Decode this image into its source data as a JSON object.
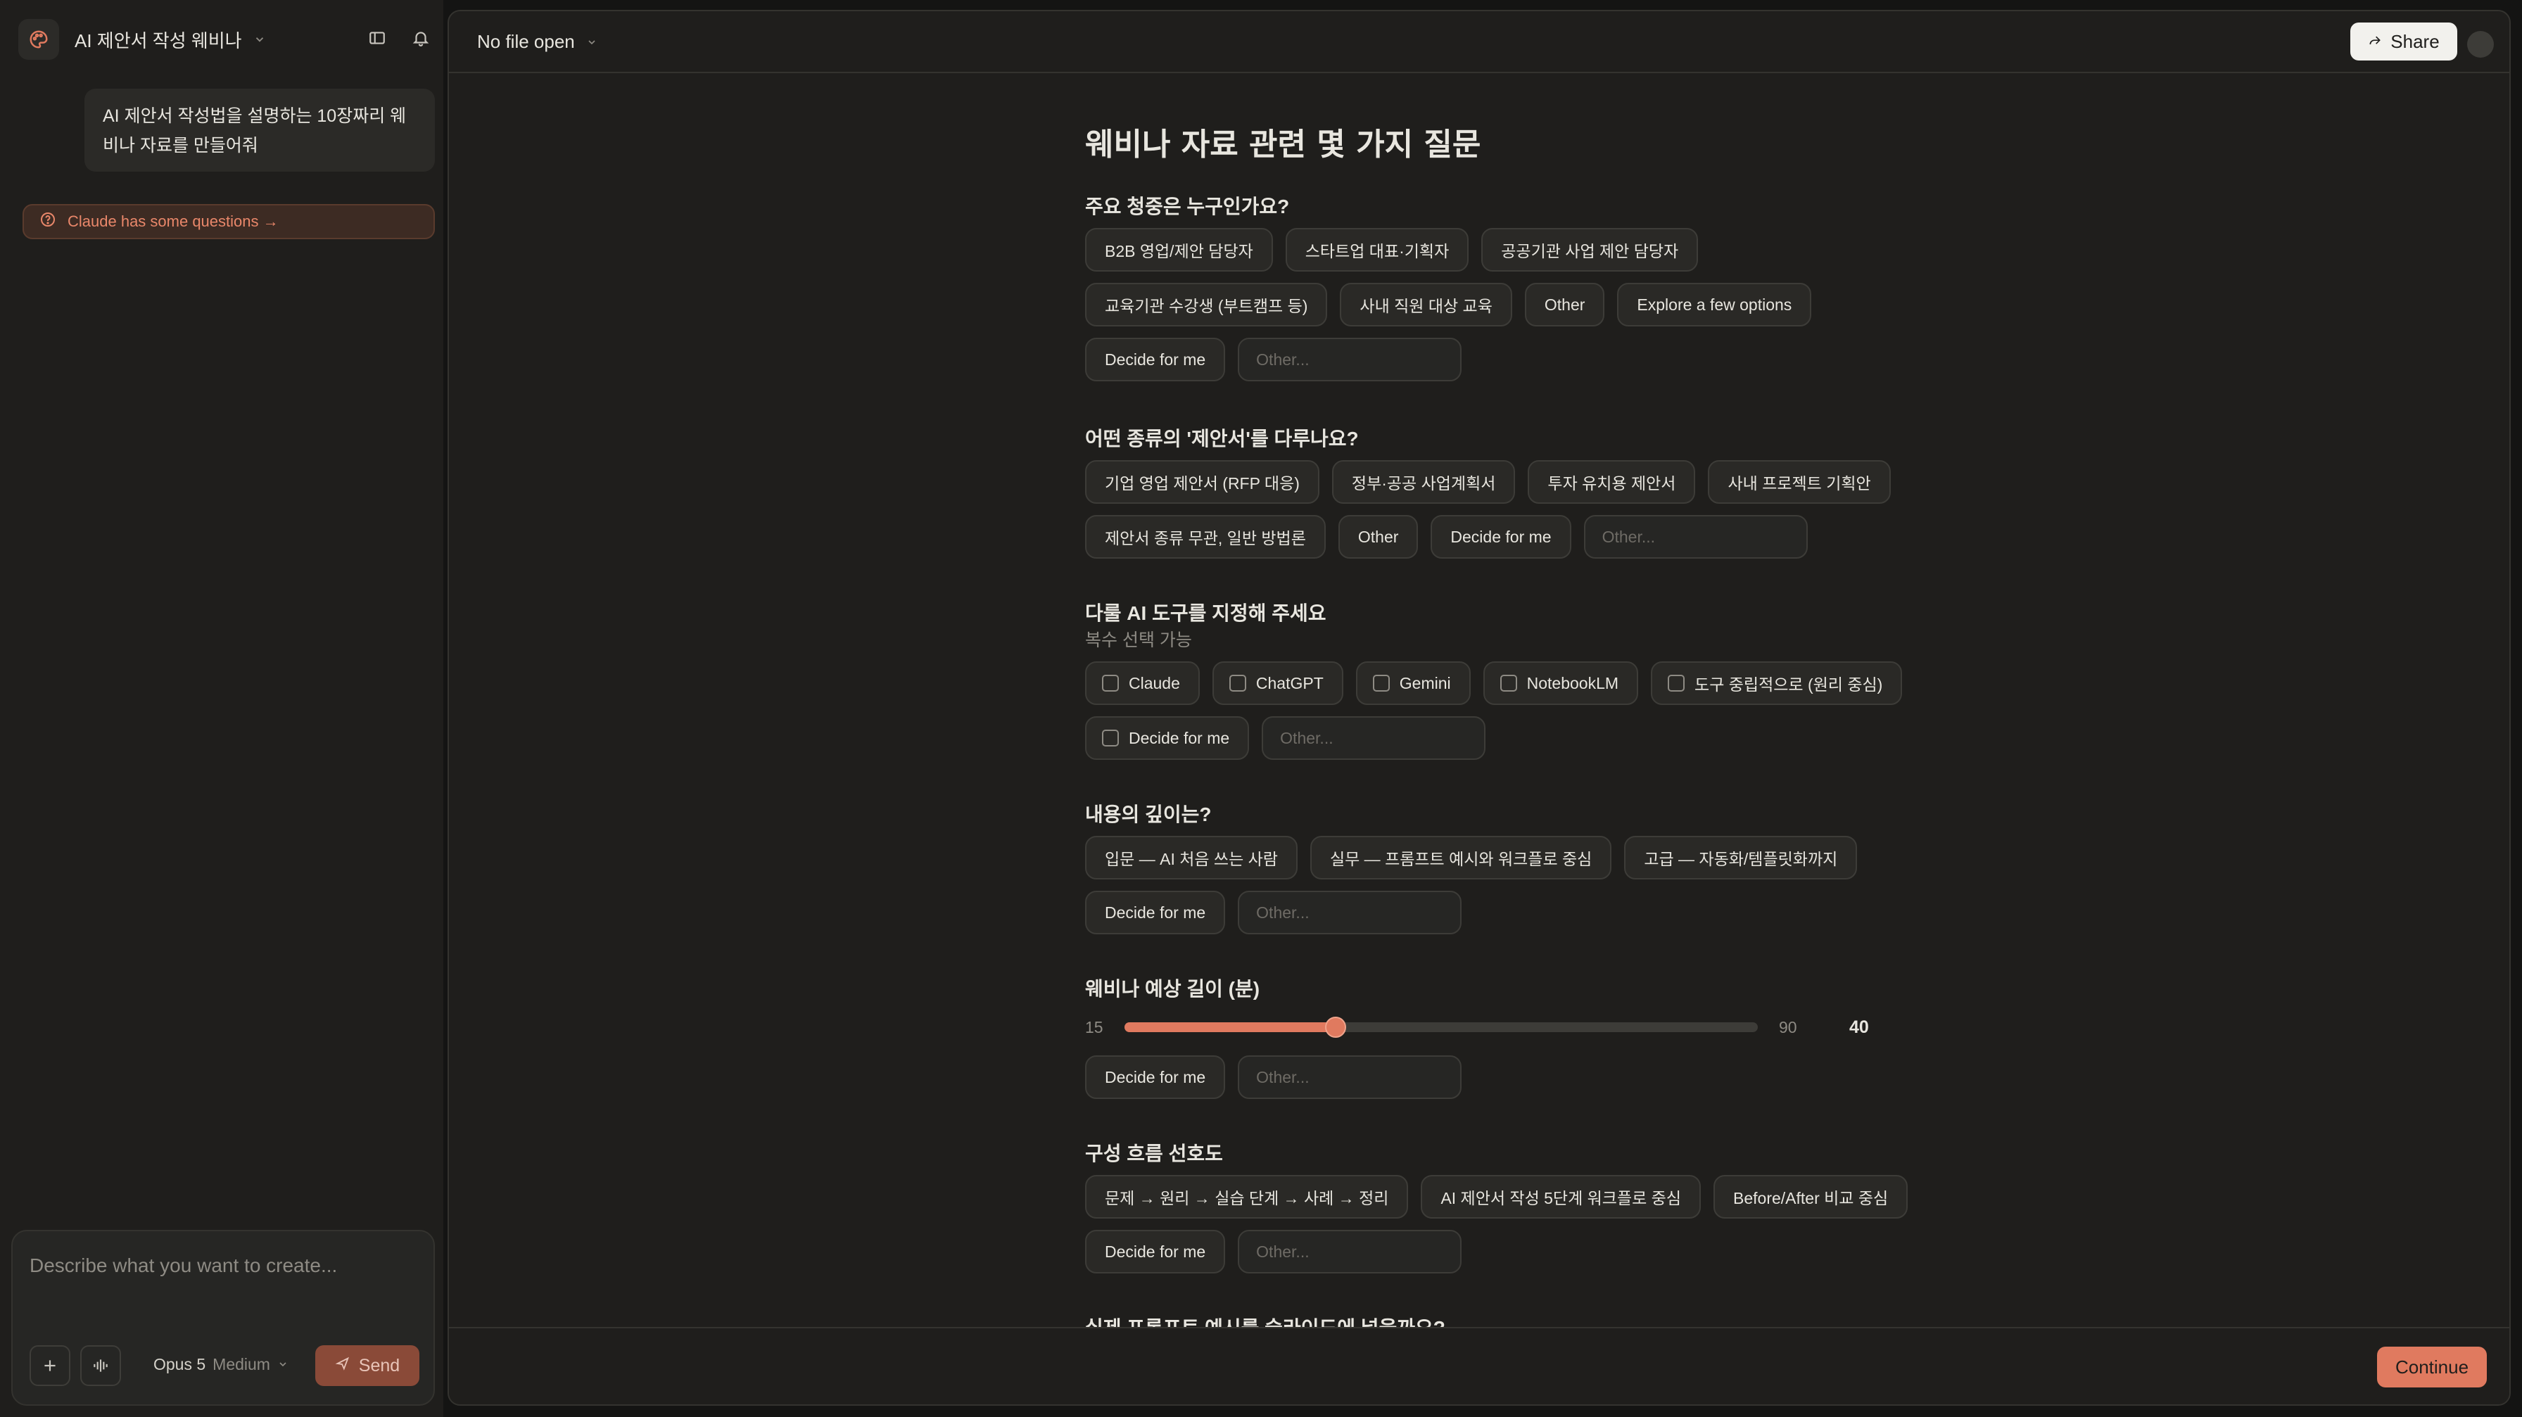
{
  "sidebar": {
    "project_title": "AI 제안서 작성 웨비나",
    "user_message": "AI 제안서 작성법을 설명하는 10장짜리 웨비나 자료를 만들어줘",
    "notice": "Claude has some questions →"
  },
  "composer": {
    "placeholder": "Describe what you want to create...",
    "model_name": "Opus 5",
    "model_effort": "Medium",
    "send_label": "Send"
  },
  "header": {
    "file_label": "No file open",
    "share_label": "Share"
  },
  "form": {
    "title": "웨비나 자료 관련 몇 가지 질문",
    "other_placeholder": "Other...",
    "questions": [
      {
        "title": "주요 청중은 누구인가요?",
        "options": [
          "B2B 영업/제안 담당자",
          "스타트업 대표·기획자",
          "공공기관 사업 제안 담당자",
          "교육기관 수강생 (부트캠프 등)",
          "사내 직원 대상 교육",
          "Other",
          "Explore a few options",
          "Decide for me"
        ]
      },
      {
        "title": "어떤 종류의 '제안서'를 다루나요?",
        "options": [
          "기업 영업 제안서 (RFP 대응)",
          "정부·공공 사업계획서",
          "투자 유치용 제안서",
          "사내 프로젝트 기획안",
          "제안서 종류 무관, 일반 방법론",
          "Other",
          "Decide for me"
        ]
      },
      {
        "title": "다룰 AI 도구를 지정해 주세요",
        "subtitle": "복수 선택 가능",
        "options": [
          "Claude",
          "ChatGPT",
          "Gemini",
          "NotebookLM",
          "도구 중립적으로 (원리 중심)",
          "Decide for me"
        ]
      },
      {
        "title": "내용의 깊이는?",
        "options": [
          "입문 — AI 처음 쓰는 사람",
          "실무 — 프롬프트 예시와 워크플로 중심",
          "고급 — 자동화/템플릿화까지",
          "Decide for me"
        ]
      },
      {
        "title": "웨비나 예상 길이 (분)",
        "slider": {
          "min": 15,
          "max": 90,
          "value": 40,
          "min_label": "15",
          "max_label": "90",
          "value_label": "40"
        },
        "options": [
          "Decide for me"
        ]
      },
      {
        "title": "구성 흐름 선호도",
        "options": [
          "문제 → 원리 → 실습 단계 → 사례 → 정리",
          "AI 제안서 작성 5단계 워크플로 중심",
          "Before/After 비교 중심",
          "Decide for me"
        ]
      },
      {
        "title": "실제 프롬프트 예시를 슬라이드에 넣을까요?"
      }
    ]
  },
  "footer": {
    "continue_label": "Continue"
  },
  "colors": {
    "accent": "#e07a5f",
    "background": "#1f1e1c",
    "notice_text": "#e9876a"
  }
}
